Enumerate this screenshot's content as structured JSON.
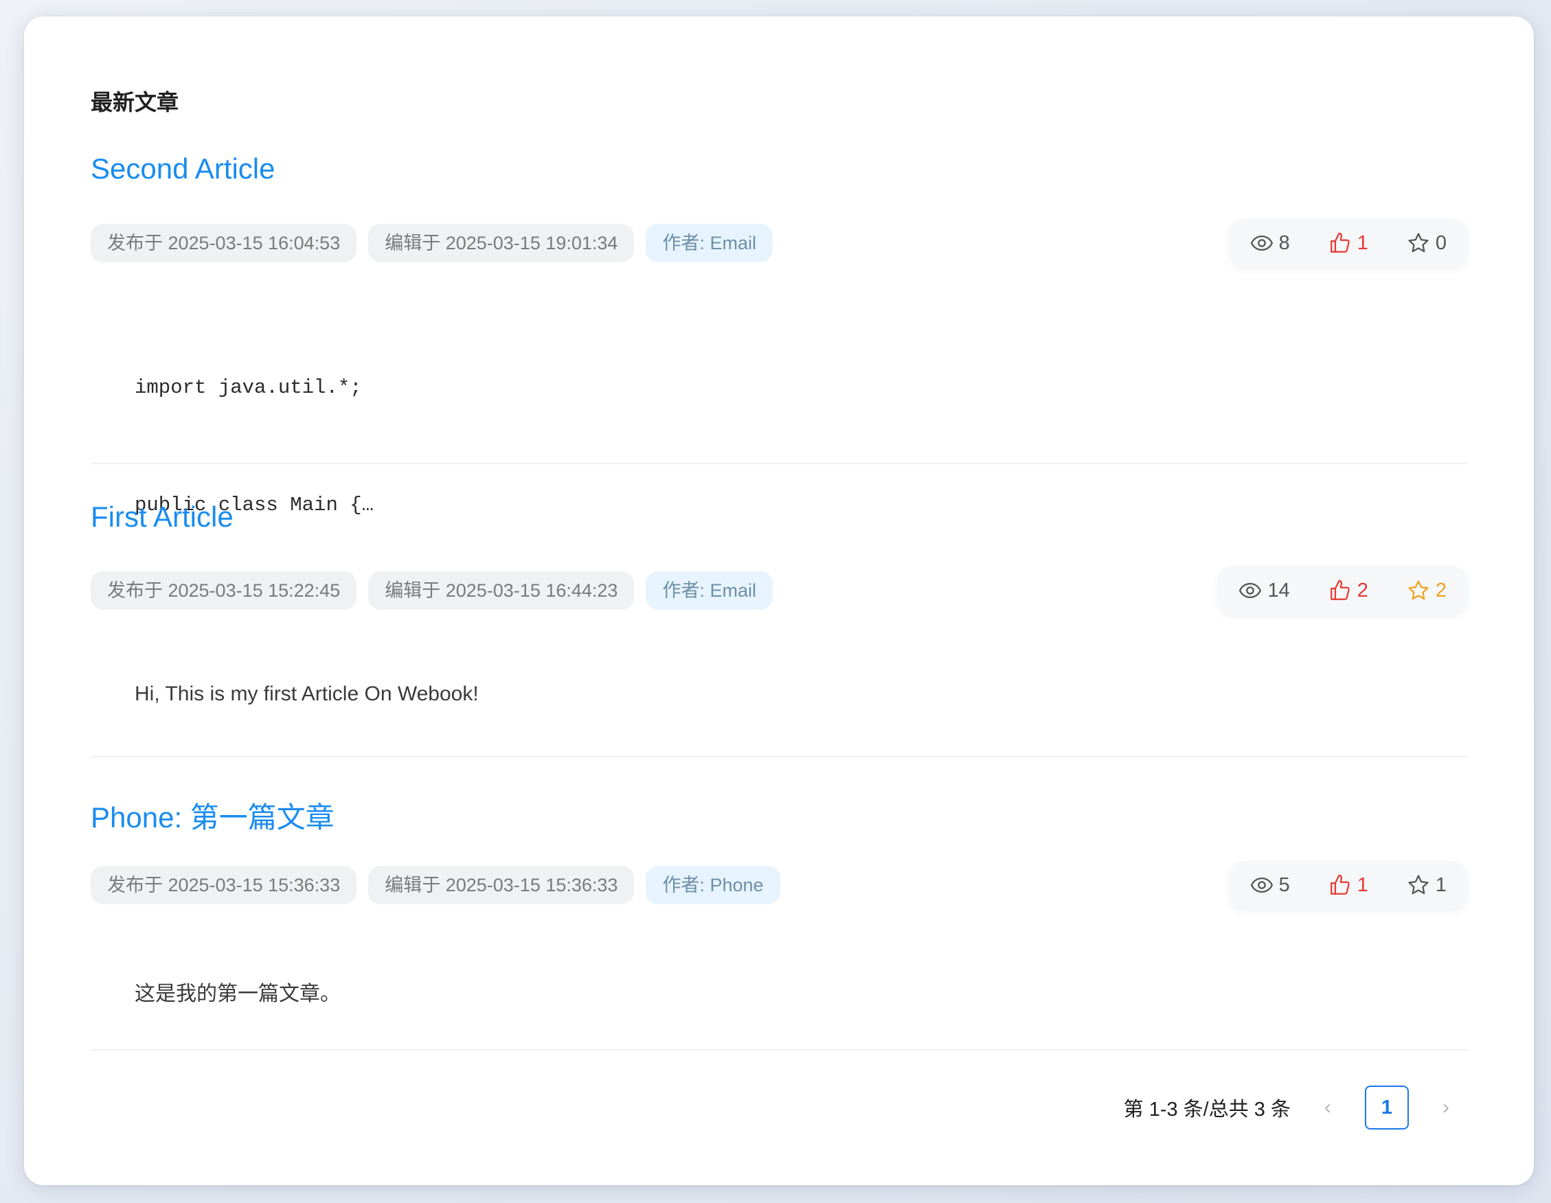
{
  "section_title": "最新文章",
  "articles": [
    {
      "title": "Second Article",
      "published": "发布于 2025-03-15 16:04:53",
      "edited": "编辑于 2025-03-15 19:01:34",
      "author": "作者: Email",
      "views": "8",
      "likes": "1",
      "favorites": "0",
      "favorite_active": false,
      "excerpt_lines": [
        "import java.util.*;",
        "public class Main {…"
      ]
    },
    {
      "title": "First Article",
      "published": "发布于 2025-03-15 15:22:45",
      "edited": "编辑于 2025-03-15 16:44:23",
      "author": "作者: Email",
      "views": "14",
      "likes": "2",
      "favorites": "2",
      "favorite_active": true,
      "excerpt": "Hi, This is my first Article On Webook!"
    },
    {
      "title": "Phone: 第一篇文章",
      "published": "发布于 2025-03-15 15:36:33",
      "edited": "编辑于 2025-03-15 15:36:33",
      "author": "作者: Phone",
      "views": "5",
      "likes": "1",
      "favorites": "1",
      "favorite_active": false,
      "excerpt": "这是我的第一篇文章。"
    }
  ],
  "pagination": {
    "total_text": "第 1-3 条/总共 3 条",
    "current_page": "1",
    "prev_symbol": "‹",
    "next_symbol": "›"
  },
  "colors": {
    "title_link": "#1a8cf0",
    "like": "#e53935",
    "favorite_active": "#f0a020",
    "page_active": "#1a78e6"
  }
}
